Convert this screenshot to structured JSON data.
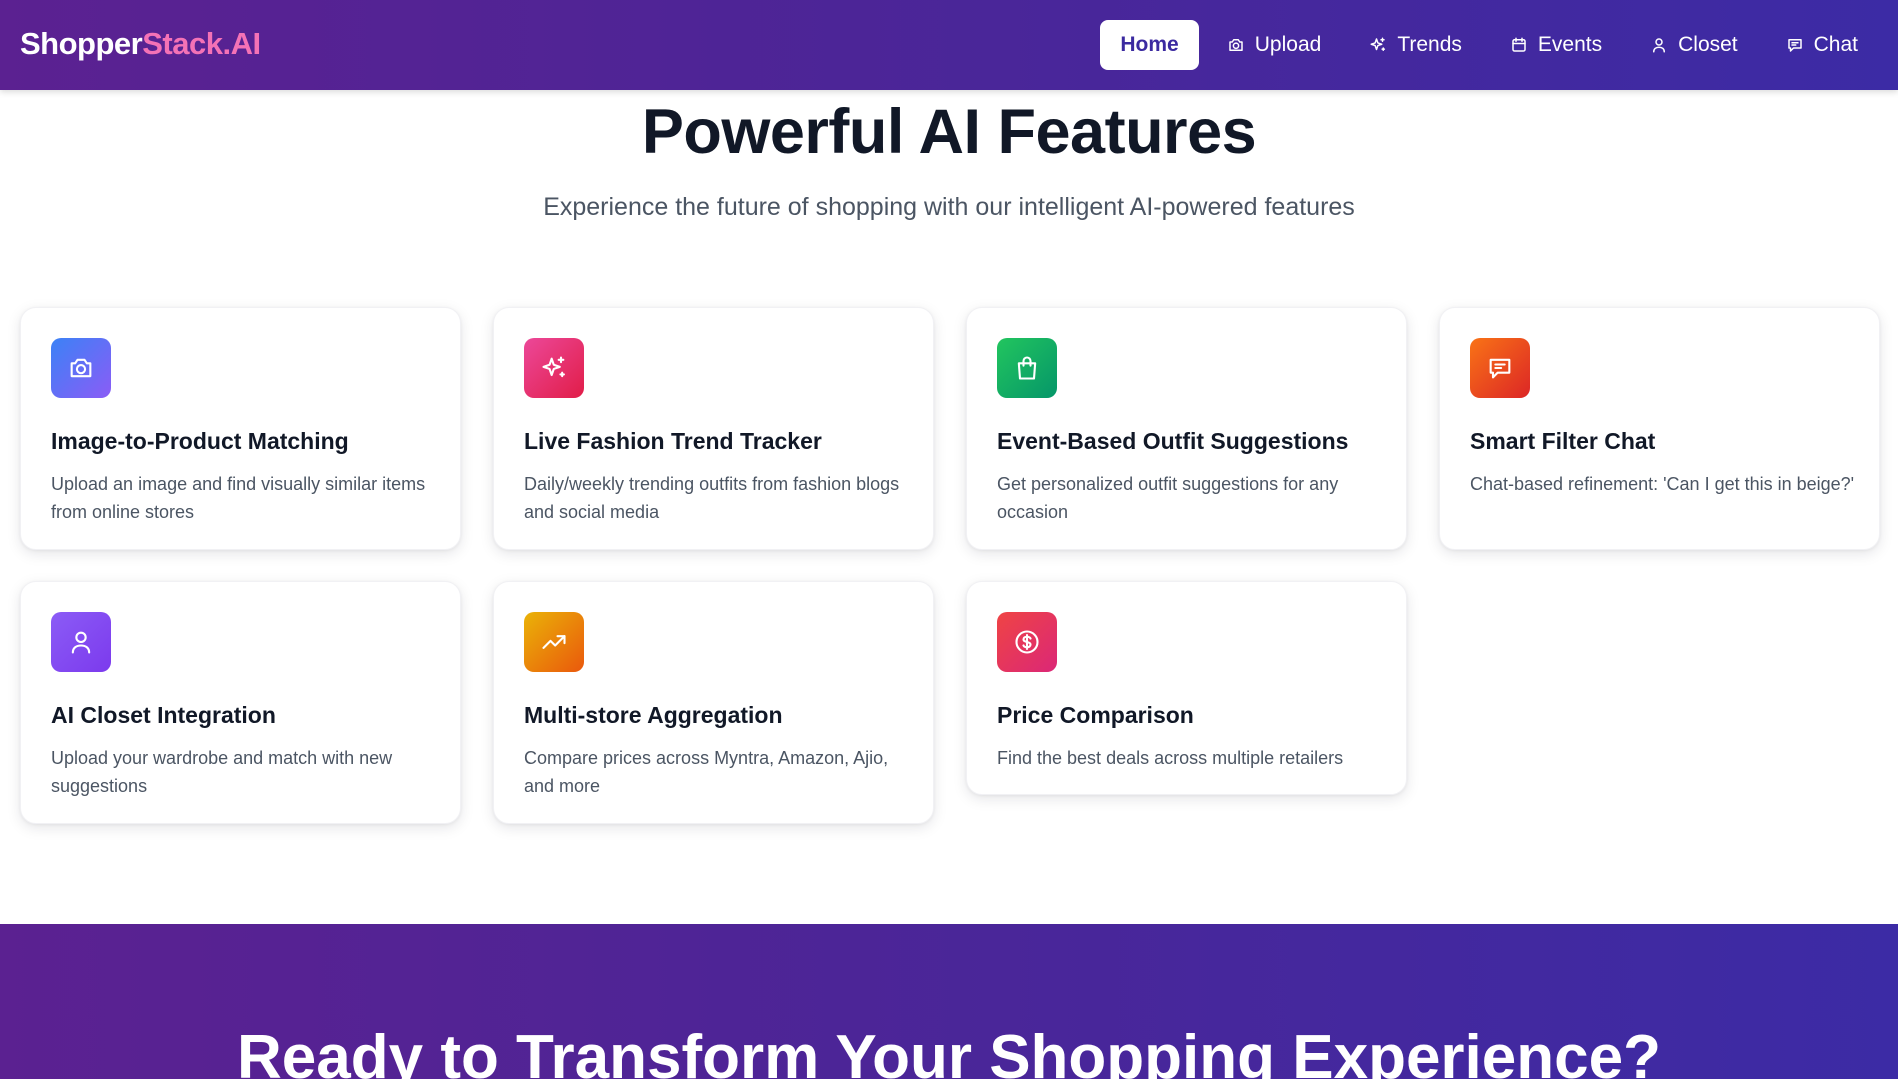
{
  "nav": {
    "logo_part1": "Shopper",
    "logo_part2": "Stack.AI",
    "items": [
      {
        "label": "Home",
        "icon": "none",
        "active": true
      },
      {
        "label": "Upload",
        "icon": "camera-icon"
      },
      {
        "label": "Trends",
        "icon": "sparkles-icon"
      },
      {
        "label": "Events",
        "icon": "calendar-icon"
      },
      {
        "label": "Closet",
        "icon": "user-icon"
      },
      {
        "label": "Chat",
        "icon": "chat-icon"
      }
    ]
  },
  "features": {
    "title": "Powerful AI Features",
    "subtitle": "Experience the future of shopping with our intelligent AI-powered features",
    "cards": [
      {
        "title": "Image-to-Product Matching",
        "description": "Upload an image and find visually similar items from online stores",
        "icon": "camera-icon",
        "color": "#6366f1"
      },
      {
        "title": "Live Fashion Trend Tracker",
        "description": "Daily/weekly trending outfits from fashion blogs and social media",
        "icon": "sparkles-icon",
        "color": "#ec4899"
      },
      {
        "title": "Event-Based Outfit Suggestions",
        "description": "Get personalized outfit suggestions for any occasion",
        "icon": "shopping-bag-icon",
        "color": "#16a34a"
      },
      {
        "title": "Smart Filter Chat",
        "description": "Chat-based refinement: 'Can I get this in beige?'",
        "icon": "chat-icon",
        "color": "#ea580c"
      },
      {
        "title": "AI Closet Integration",
        "description": "Upload your wardrobe and match with new suggestions",
        "icon": "user-icon",
        "color": "#8b5cf6"
      },
      {
        "title": "Multi-store Aggregation",
        "description": "Compare prices across Myntra, Amazon, Ajio, and more",
        "icon": "trending-up-icon",
        "color": "#f59e0b"
      },
      {
        "title": "Price Comparison",
        "description": "Find the best deals across multiple retailers",
        "icon": "dollar-icon",
        "color": "#ef4444"
      }
    ]
  },
  "cta": {
    "title": "Ready to Transform Your Shopping Experience?"
  },
  "colors": {
    "brand_purple": "#4c2597",
    "logo_accent": "#f472b6",
    "active_nav_text": "#3b2aa0"
  }
}
